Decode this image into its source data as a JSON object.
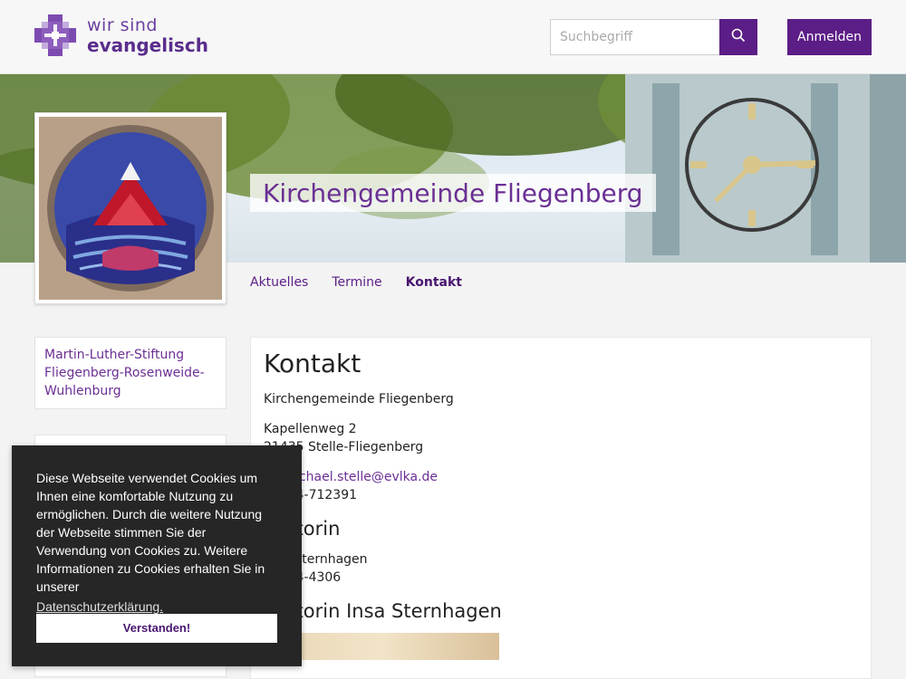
{
  "header": {
    "logo_line1": "wir sind",
    "logo_line2": "evangelisch",
    "search_placeholder": "Suchbegriff",
    "search_icon": "search-icon",
    "login_label": "Anmelden",
    "accent_color": "#5b1d86"
  },
  "hero": {
    "title": "Kirchengemeinde Fliegenberg"
  },
  "nav": {
    "tabs": [
      {
        "label": "Aktuelles",
        "active": false
      },
      {
        "label": "Termine",
        "active": false
      },
      {
        "label": "Kontakt",
        "active": true
      }
    ]
  },
  "sidebar": {
    "link_text": "Martin-Luther-Stiftung Fliegenberg-Rosenweide-Wuhlenburg"
  },
  "content": {
    "heading": "Kontakt",
    "org": "Kirchengemeinde Fliegenberg",
    "address_line1": "Kapellenweg 2",
    "address_line2": "21435 Stelle-Fliegenberg",
    "email": "kg.michael.stelle@evlka.de",
    "phone": "04174-712391",
    "section2_heading": "Pastorin",
    "section2_line1": "Insa Sternhagen",
    "section2_line2": "04174-4306",
    "section3_heading": "Pastorin Insa Sternhagen"
  },
  "cookie": {
    "text": "Diese Webseite verwendet Cookies um Ihnen eine komfortable Nutzung zu ermöglichen. Durch die weitere Nutzung der Webseite stimmen Sie der Verwendung von Cookies zu. Weitere Informationen zu Cookies erhalten Sie in unserer",
    "link": "Datenschutzerklärung.",
    "button": "Verstanden!"
  }
}
